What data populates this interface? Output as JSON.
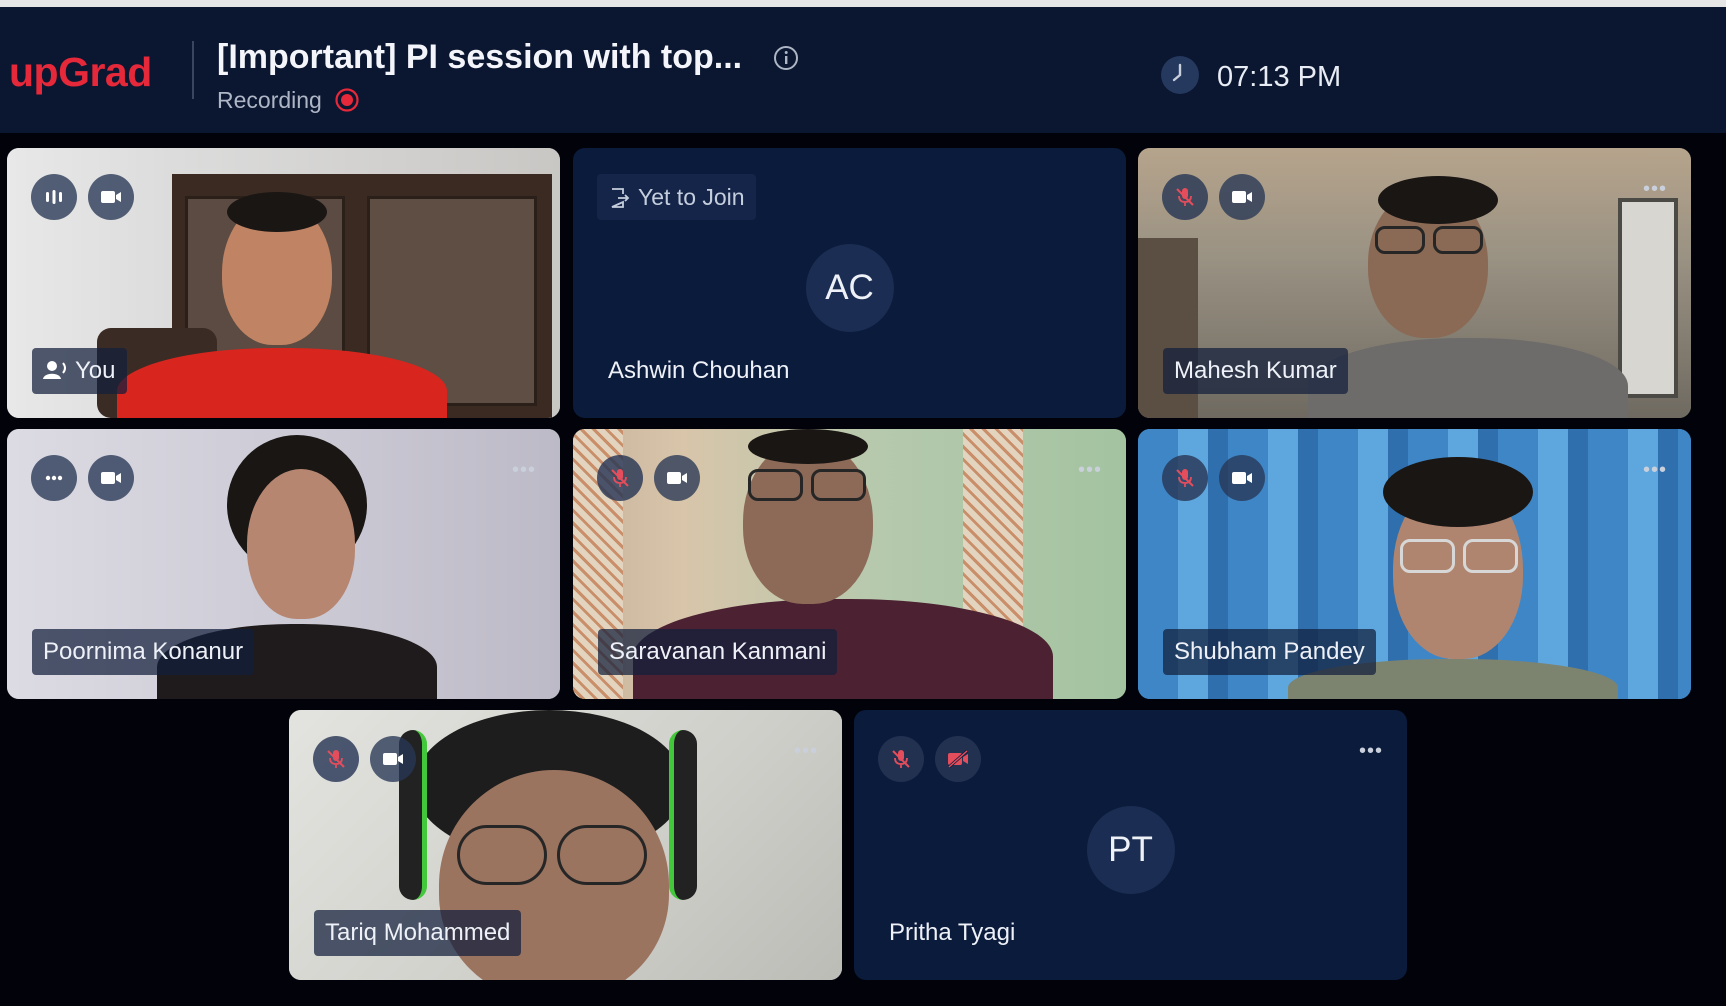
{
  "header": {
    "logo": "upGrad",
    "title": "[Important] PI session with top...",
    "status": "Recording",
    "time": "07:13 PM"
  },
  "participants": [
    {
      "name": "You",
      "initials": "",
      "video_on": true,
      "mic": "speaking",
      "speaking": true
    },
    {
      "name": "Ashwin Chouhan",
      "initials": "AC",
      "video_on": false,
      "status": "Yet to Join"
    },
    {
      "name": "Mahesh Kumar",
      "initials": "",
      "video_on": true,
      "mic": "muted"
    },
    {
      "name": "Poornima Konanur",
      "initials": "",
      "video_on": true,
      "mic": "speaking-dots"
    },
    {
      "name": "Saravanan Kanmani",
      "initials": "",
      "video_on": true,
      "mic": "muted"
    },
    {
      "name": "Shubham Pandey",
      "initials": "",
      "video_on": true,
      "mic": "muted"
    },
    {
      "name": "Tariq Mohammed",
      "initials": "",
      "video_on": true,
      "mic": "muted"
    },
    {
      "name": "Pritha Tyagi",
      "initials": "PT",
      "video_on": false,
      "mic": "muted",
      "camera": "off"
    }
  ],
  "colors": {
    "brand": "#e5283a",
    "header_bg": "#0b1630",
    "tile_bg": "#0b1b3c",
    "muted_icon": "#e34d5c"
  },
  "icons": {
    "info": "info-icon",
    "recording": "recording-dot-icon",
    "clock": "clock-icon",
    "mic_muted": "mic-muted-icon",
    "camera": "camera-icon",
    "camera_off": "camera-off-icon",
    "more": "more-icon",
    "join": "join-door-icon"
  }
}
